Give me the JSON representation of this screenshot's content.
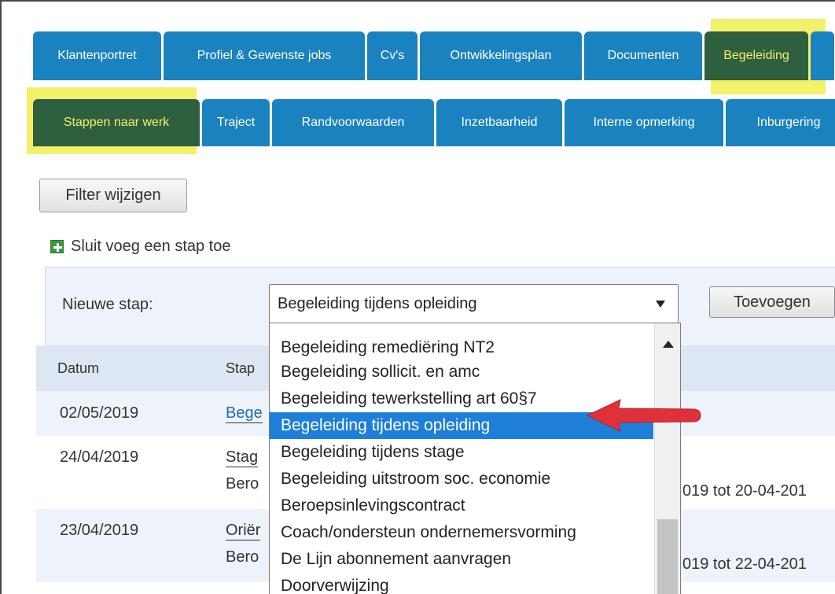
{
  "tabs_main": [
    {
      "label": "Klantenportret"
    },
    {
      "label": "Profiel & Gewenste jobs"
    },
    {
      "label": "Cv's"
    },
    {
      "label": "Ontwikkelingsplan"
    },
    {
      "label": "Documenten"
    },
    {
      "label": "Begeleiding",
      "active": true
    }
  ],
  "tabs_sub": [
    {
      "label": "Stappen naar werk",
      "active": true
    },
    {
      "label": "Traject"
    },
    {
      "label": "Randvoorwaarden"
    },
    {
      "label": "Inzetbaarheid"
    },
    {
      "label": "Interne opmerking"
    },
    {
      "label": "Inburgering"
    }
  ],
  "filter_button": "Filter wijzigen",
  "add_step_link": "Sluit voeg een stap toe",
  "form": {
    "label": "Nieuwe stap:",
    "selected_value": "Begeleiding tijdens opleiding",
    "submit_label": "Toevoegen"
  },
  "dropdown": {
    "options": [
      "Begeleiding remediëring NT2",
      "Begeleiding sollicit. en amc",
      "Begeleiding tewerkstelling art 60§7",
      "Begeleiding tijdens opleiding",
      "Begeleiding tijdens stage",
      "Begeleiding uitstroom soc. economie",
      "Beroepsinlevingscontract",
      "Coach/ondersteun ondernemersvorming",
      "De Lijn abonnement aanvragen",
      "Doorverwijzing"
    ],
    "selected_index": 3
  },
  "table": {
    "headers": [
      "Datum",
      "Stap"
    ],
    "rows": [
      {
        "date": "02/05/2019",
        "stap": "Bege"
      },
      {
        "date": "24/04/2019",
        "stap": "Stag",
        "stap2": "Bero",
        "period": "019 tot 20-04-201"
      },
      {
        "date": "23/04/2019",
        "stap": "Oriër",
        "stap2": "Bero",
        "period": "019 tot 22-04-201"
      }
    ]
  },
  "colors": {
    "tab_blue": "#1a82bf",
    "tab_active": "#2e5f3e",
    "highlight": "#f3f06a",
    "selected_option": "#1e7fd8",
    "arrow": "#e0303a"
  }
}
